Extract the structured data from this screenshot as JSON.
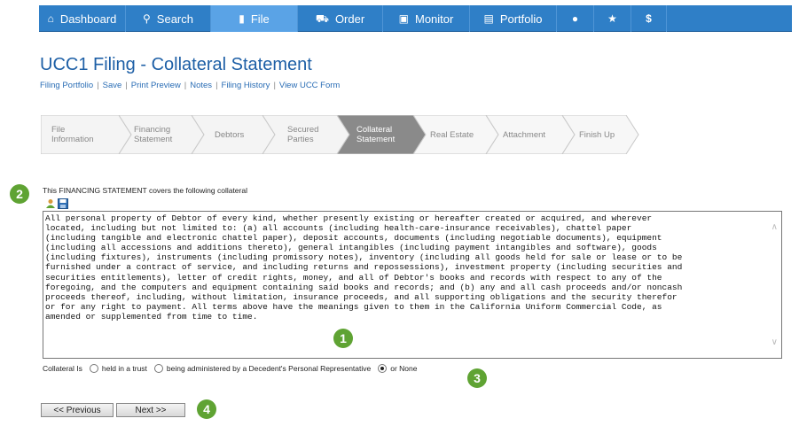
{
  "nav": [
    {
      "label": "Dashboard",
      "icon": "home-icon",
      "glyph": "⌂"
    },
    {
      "label": "Search",
      "icon": "search-icon",
      "glyph": "⚲"
    },
    {
      "label": "File",
      "icon": "file-icon",
      "glyph": "▮",
      "active": true
    },
    {
      "label": "Order",
      "icon": "cart-icon",
      "glyph": "⛟"
    },
    {
      "label": "Monitor",
      "icon": "monitor-icon",
      "glyph": "▣"
    },
    {
      "label": "Portfolio",
      "icon": "portfolio-icon",
      "glyph": "▤"
    },
    {
      "label": "",
      "icon": "user-icon",
      "glyph": "●"
    },
    {
      "label": "",
      "icon": "star-icon",
      "glyph": "★"
    },
    {
      "label": "",
      "icon": "dollar-icon",
      "glyph": "$"
    }
  ],
  "page": {
    "title": "UCC1 Filing - Collateral Statement",
    "links": [
      "Filing Portfolio",
      "Save",
      "Print Preview",
      "Notes",
      "Filing History",
      "View UCC Form"
    ]
  },
  "wizard": {
    "steps": [
      {
        "line1": "File",
        "line2": "Information"
      },
      {
        "line1": "Financing",
        "line2": "Statement"
      },
      {
        "line1": "Debtors",
        "line2": ""
      },
      {
        "line1": "Secured",
        "line2": "Parties"
      },
      {
        "line1": "Collateral",
        "line2": "Statement",
        "active": true
      },
      {
        "line1": "Real Estate",
        "line2": ""
      },
      {
        "line1": "Attachment",
        "line2": ""
      },
      {
        "line1": "Finish Up",
        "line2": ""
      }
    ]
  },
  "section": {
    "title": "This FINANCING STATEMENT covers the following collateral",
    "collateral_text": "All personal property of Debtor of every kind, whether presently existing or hereafter created or acquired, and wherever\nlocated, including but not limited to: (a) all accounts (including health-care-insurance receivables), chattel paper\n(including tangible and electronic chattel paper), deposit accounts, documents (including negotiable documents), equipment\n(including all accessions and additions thereto), general intangibles (including payment intangibles and software), goods\n(including fixtures), instruments (including promissory notes), inventory (including all goods held for sale or lease or to be\nfurnished under a contract of service, and including returns and repossessions), investment property (including securities and\nsecurities entitlements), letter of credit rights, money, and all of Debtor's books and records with respect to any of the\nforegoing, and the computers and equipment containing said books and records; and (b) any and all cash proceeds and/or noncash\nproceeds thereof, including, without limitation, insurance proceeds, and all supporting obligations and the security therefor\nor for any right to payment. All terms above have the meanings given to them in the California Uniform Commercial Code, as\namended or supplemented from time to time."
  },
  "collateral_is": {
    "label": "Collateral Is",
    "options": [
      {
        "label": "held in a trust",
        "checked": false
      },
      {
        "label": "being administered by a Decedent's Personal Representative",
        "checked": false
      },
      {
        "label": "or None",
        "checked": true
      }
    ]
  },
  "buttons": {
    "previous": "<< Previous",
    "next": "Next >>"
  },
  "badges": [
    "1",
    "2",
    "3",
    "4"
  ],
  "colors": {
    "nav": "#2f7fc7",
    "nav_active": "#5aa3e6",
    "title": "#1d5fa6",
    "badge": "#5fa333",
    "wizard_active": "#8a8a8a"
  }
}
